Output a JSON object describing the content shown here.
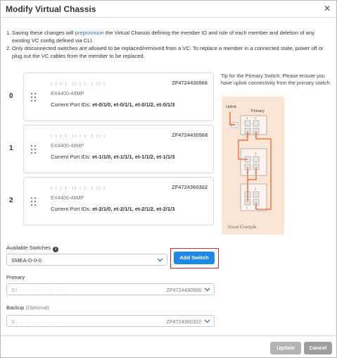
{
  "dialog": {
    "title": "Modify Virtual Chassis",
    "close_glyph": "✕"
  },
  "notes": [
    {
      "num": "1.",
      "text_before": "Saving these changes will ",
      "link": "preprovision",
      "text_after": " the Virtual Chassis defining the member ID and role of each member and deletion of any existing VC config defined via CLI."
    },
    {
      "num": "2.",
      "text": "Only disconnected switches are allowed to be replaced/removed from a VC. To replace a member in a connected state, power off or plug out the VC cables from the member to be replaced."
    }
  ],
  "members": [
    {
      "index": "0",
      "name_blurred": "ꞁ·ꞁ ꞁ·ꞁ· ꞁꞁ·ꞁ ꞁ· ꞁ·ꞁꞁ·ꞁ",
      "serial": "ZF4724430566",
      "model": "EX4400-48MP",
      "ports_label": "Current Port IDs: ",
      "ports": "et-0/1/0, et-0/1/1, et-0/1/2, et-0/1/3"
    },
    {
      "index": "1",
      "name_blurred": "ꞁ·ꞁ ꞁ·ꞁ· ꞁꞁ·ꞁ ꞁ· ꞁ·ꞁꞁ·ꞁ",
      "serial": "ZF4724430568",
      "model": "EX4400-48MP",
      "ports_label": "Current Port IDs: ",
      "ports": "et-1/1/0, et-1/1/1, et-1/1/2, et-1/1/3"
    },
    {
      "index": "2",
      "name_blurred": "ꞁ·ꞁ ꞁ·ꞁ· ꞁꞁ·ꞁ ꞁ· ꞁ·ꞁꞁ·ꞁ",
      "serial": "ZF4724360322",
      "model": "EX4400-48MP",
      "ports_label": "Current Port IDs: ",
      "ports": "et-2/1/0, et-2/1/1, et-2/1/2, et-2/1/3"
    }
  ],
  "tip": {
    "text": "Tip for the Primary Switch: Please ensure you have uplink connectivity from the primary switch.",
    "diagram_uplink": "Uplink",
    "diagram_primary": "Primary",
    "diagram_label": "Visual Example",
    "port_numbers": [
      "0",
      "2",
      "1",
      "3",
      "2",
      "1",
      "3",
      "2",
      "1",
      "3"
    ]
  },
  "available_switches": {
    "label": "Available Switches",
    "info_glyph": "i",
    "value": "SMEA-D-0-0",
    "add_button": "Add Switch"
  },
  "primary": {
    "label": "Primary",
    "value_blurred": "Sl··· ·· ···· ··· ·····",
    "serial": "ZF4724430566"
  },
  "backup": {
    "label": "Backup",
    "optional": "(Optional)",
    "value_blurred": "S··· ·· ··· ·· ·····",
    "serial": "ZF4724360322"
  },
  "footer": {
    "update": "Update",
    "cancel": "Cancel"
  },
  "colors": {
    "accent": "#1e88e5",
    "link": "#2b73b7",
    "highlight": "#d9262b",
    "diagram_bg": "#fbe6d6",
    "diagram_line": "#e8622a"
  }
}
